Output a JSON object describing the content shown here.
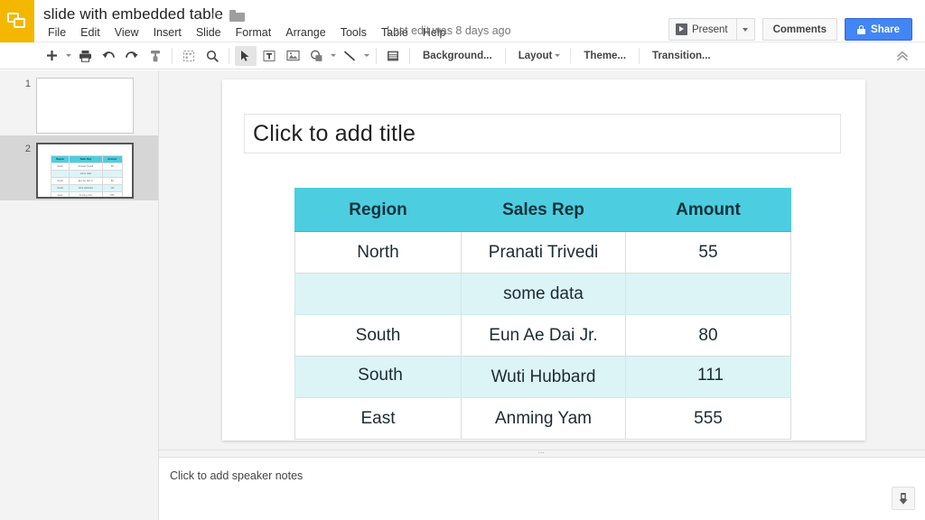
{
  "app": {
    "logo_icon": "slides-logo-icon",
    "brand_color": "#f3b700"
  },
  "header": {
    "doc_title": "slide with embedded table",
    "star_icon": "star-outline-icon",
    "folder_icon": "folder-icon",
    "last_edit": "Last edit was 8 days ago",
    "menus": [
      "File",
      "Edit",
      "View",
      "Insert",
      "Slide",
      "Format",
      "Arrange",
      "Tools",
      "Table",
      "Help"
    ],
    "present_label": "Present",
    "present_icon": "play-icon",
    "present_caret_icon": "chevron-down-icon",
    "comments_label": "Comments",
    "share_label": "Share",
    "share_icon": "lock-icon",
    "share_color": "#4285f4"
  },
  "toolbar": {
    "new_slide_icon": "plus-icon",
    "new_slide_caret_icon": "chevron-down-icon",
    "print_icon": "print-icon",
    "undo_icon": "undo-icon",
    "redo_icon": "redo-icon",
    "paint_format_icon": "paint-format-icon",
    "zoom_fit_icon": "zoom-fit-icon",
    "zoom_icon": "magnifier-icon",
    "select_icon": "cursor-arrow-icon",
    "textbox_icon": "text-box-icon",
    "image_icon": "image-icon",
    "shape_icon": "shape-icon",
    "shape_caret_icon": "chevron-down-icon",
    "line_icon": "line-icon",
    "line_caret_icon": "chevron-down-icon",
    "layout_icon": "layout-icon",
    "background_label": "Background...",
    "layout_label": "Layout",
    "layout_caret_icon": "chevron-down-icon",
    "theme_label": "Theme...",
    "transition_label": "Transition...",
    "collapse_icon": "double-chevron-up-icon"
  },
  "filmstrip": {
    "slides": [
      {
        "number": "1",
        "selected": false
      },
      {
        "number": "2",
        "selected": true
      }
    ]
  },
  "slide": {
    "title_placeholder": "Click to add title"
  },
  "table": {
    "header_bg": "#4ccee0",
    "alt_row_bg": "#ddf4f7",
    "headers": [
      "Region",
      "Sales Rep",
      "Amount"
    ],
    "rows": [
      {
        "alt": false,
        "cells": [
          {
            "text": "North",
            "small": false
          },
          {
            "text": "Pranati Trivedi",
            "small": false
          },
          {
            "text": "55",
            "small": false
          }
        ]
      },
      {
        "alt": true,
        "cells": [
          {
            "text": "",
            "small": false
          },
          {
            "text": "some data",
            "small": false
          },
          {
            "text": "",
            "small": false
          }
        ]
      },
      {
        "alt": false,
        "cells": [
          {
            "text": "South",
            "small": false
          },
          {
            "text": "Eun Ae Dai Jr.",
            "small": false
          },
          {
            "text": "80",
            "small": false
          }
        ]
      },
      {
        "alt": true,
        "cells": [
          {
            "text": "South",
            "small": true
          },
          {
            "text": "Wuti Hubbard",
            "small": false
          },
          {
            "text": "111",
            "small": true
          }
        ]
      },
      {
        "alt": false,
        "cells": [
          {
            "text": "East",
            "small": false
          },
          {
            "text": "Anming Yam",
            "small": false
          },
          {
            "text": "555",
            "small": false
          }
        ]
      }
    ]
  },
  "notes": {
    "placeholder": "Click to add speaker notes",
    "grip_icon": "drag-grip-icon",
    "explore_icon": "explore-icon"
  }
}
